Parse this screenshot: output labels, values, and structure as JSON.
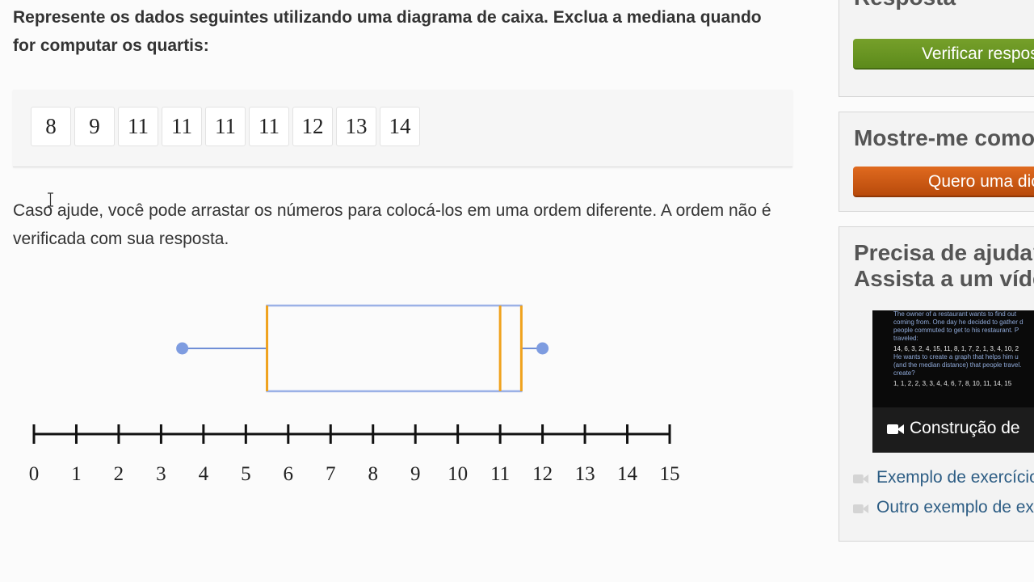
{
  "question": {
    "prompt": "Represente os dados seguintes utilizando uma diagrama de caixa. Exclua a mediana quando for computar os quartis:",
    "tiles": [
      "8",
      "9",
      "11",
      "11",
      "11",
      "11",
      "12",
      "13",
      "14"
    ],
    "hint": "Caso ajude, você pode arrastar os números para colocá-los em uma ordem diferente. A ordem não é verificada com sua resposta."
  },
  "plot": {
    "axis_ticks": [
      "0",
      "1",
      "2",
      "3",
      "4",
      "5",
      "6",
      "7",
      "8",
      "9",
      "10",
      "11",
      "12",
      "13",
      "14",
      "15"
    ],
    "axis_range": [
      0,
      15
    ],
    "box_plot": {
      "min": 3.5,
      "q1": 5.5,
      "median": 11,
      "q3": 11.5,
      "max": 12
    },
    "colors": {
      "box": "#9bb1e6",
      "median_lines": "#f0a21c",
      "whisker": "#6f8ed6",
      "handle": "#7e9ce0"
    }
  },
  "sidebar": {
    "answer_title": "Resposta",
    "check_button": "Verificar resposta",
    "show_me_title": "Mostre-me como",
    "hint_button": "Quero uma dica",
    "help_title_1": "Precisa de ajuda?",
    "help_title_2": "Assista a um vídeo",
    "video_caption": "Construção de",
    "video_text": [
      "The owner of a restaurant wants to find out",
      "coming from. One day he decided to gather d",
      "people commuted to get to his restaurant. P",
      "traveled:",
      "14, 6, 3, 2, 4, 15, 11, 8, 1, 7, 2, 1, 3, 4, 10, 2",
      "He wants to create a graph that helps him u",
      "(and the median distance) that people travel.",
      "create?",
      "1, 1, 2, 2, 3, 3, 4, 4, 6, 7, 8, 10, 11, 14, 15"
    ],
    "example_link_1": "Exemplo de exercício",
    "example_link_2": "Outro exemplo de exercício"
  }
}
